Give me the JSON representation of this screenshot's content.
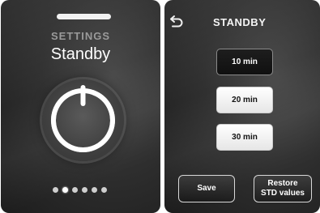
{
  "left_screen": {
    "overline": "SETTINGS",
    "title": "Standby",
    "page_count": 6,
    "active_page": 1
  },
  "right_screen": {
    "title": "STANDBY",
    "options": [
      {
        "label": "10 min",
        "selected": true
      },
      {
        "label": "20 min",
        "selected": false
      },
      {
        "label": "30 min",
        "selected": false
      }
    ],
    "save_label": "Save",
    "restore_label_line1": "Restore",
    "restore_label_line2": "STD values"
  },
  "icons": [
    "power-icon",
    "back-arrow-icon"
  ]
}
